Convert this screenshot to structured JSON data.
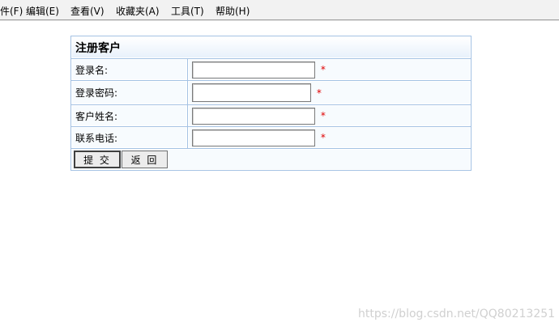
{
  "menubar": {
    "items": [
      {
        "label": "文件(F)"
      },
      {
        "label": "编辑(E)"
      },
      {
        "label": "查看(V)"
      },
      {
        "label": "收藏夹(A)"
      },
      {
        "label": "工具(T)"
      },
      {
        "label": "帮助(H)"
      }
    ]
  },
  "form": {
    "title": "注册客户",
    "fields": [
      {
        "label": "登录名:",
        "value": "",
        "required_mark": "*"
      },
      {
        "label": "登录密码:",
        "value": "",
        "required_mark": "*"
      },
      {
        "label": "客户姓名:",
        "value": "",
        "required_mark": "*"
      },
      {
        "label": "联系电话:",
        "value": "",
        "required_mark": "*"
      }
    ],
    "submit_label": "提 交",
    "back_label": "返 回"
  },
  "watermark": "https://blog.csdn.net/QQ80213251",
  "colors": {
    "border": "#a4c2e4",
    "cell_bg": "#f7fbfe",
    "required": "#e00000"
  }
}
